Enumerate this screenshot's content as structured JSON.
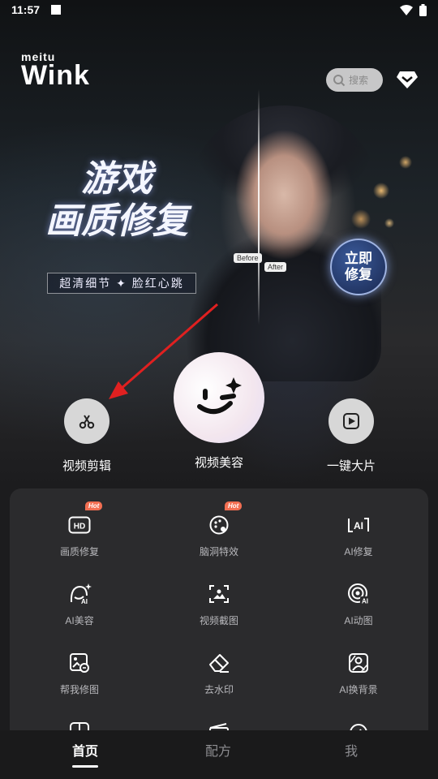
{
  "status_bar": {
    "time": "11:57"
  },
  "brand": {
    "small": "meitu",
    "big": "Wink"
  },
  "search": {
    "placeholder": "搜索"
  },
  "promo": {
    "title_line1": "游戏",
    "title_line2": "画质修复",
    "subtitle": "超清细节 ✦ 脸红心跳",
    "badge": "立即修复",
    "before_label": "Before",
    "after_label": "After"
  },
  "main_actions": [
    {
      "label": "视频剪辑",
      "icon": "scissors-icon"
    },
    {
      "label": "视频美容",
      "icon": "wink-face-icon"
    },
    {
      "label": "一键大片",
      "icon": "play-icon"
    }
  ],
  "tools": [
    {
      "label": "画质修复",
      "icon": "hd-icon",
      "hot": "Hot"
    },
    {
      "label": "脑洞特效",
      "icon": "palette-icon",
      "hot": "Hot"
    },
    {
      "label": "AI修复",
      "icon": "ai-repair-icon",
      "hot": ""
    },
    {
      "label": "AI美容",
      "icon": "ai-beauty-icon",
      "hot": ""
    },
    {
      "label": "视频截图",
      "icon": "screenshot-icon",
      "hot": ""
    },
    {
      "label": "AI动图",
      "icon": "ai-animate-icon",
      "hot": ""
    },
    {
      "label": "帮我修图",
      "icon": "photo-edit-icon",
      "hot": ""
    },
    {
      "label": "去水印",
      "icon": "eraser-icon",
      "hot": ""
    },
    {
      "label": "AI换背景",
      "icon": "bg-swap-icon",
      "hot": ""
    }
  ],
  "tabs": [
    {
      "label": "首页",
      "active": true
    },
    {
      "label": "配方",
      "active": false
    },
    {
      "label": "我",
      "active": false
    }
  ],
  "colors": {
    "background": "#1c1c1e",
    "panel": "#2b2b2d",
    "hot_badge": "#f36f52",
    "arrow": "#e02020"
  }
}
